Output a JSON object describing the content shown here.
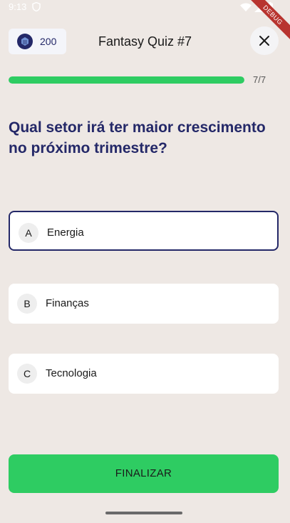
{
  "status_bar": {
    "time": "9:13",
    "icons": [
      "shield-icon",
      "wifi-icon",
      "signal-icon",
      "battery-icon"
    ]
  },
  "debug_banner": "DEBUG",
  "header": {
    "coins": "200",
    "title": "Fantasy Quiz #7",
    "close_icon": "close-icon"
  },
  "progress": {
    "label": "7/7",
    "fraction": 1.0
  },
  "question": "Qual setor irá ter maior crescimento no próximo trimestre?",
  "answers": [
    {
      "letter": "A",
      "text": "Energia",
      "selected": true
    },
    {
      "letter": "B",
      "text": "Finanças",
      "selected": false
    },
    {
      "letter": "C",
      "text": "Tecnologia",
      "selected": false
    }
  ],
  "finish_button": "FINALIZAR",
  "colors": {
    "background": "#eee8e4",
    "accent": "#2ecc62",
    "primary": "#242868"
  }
}
